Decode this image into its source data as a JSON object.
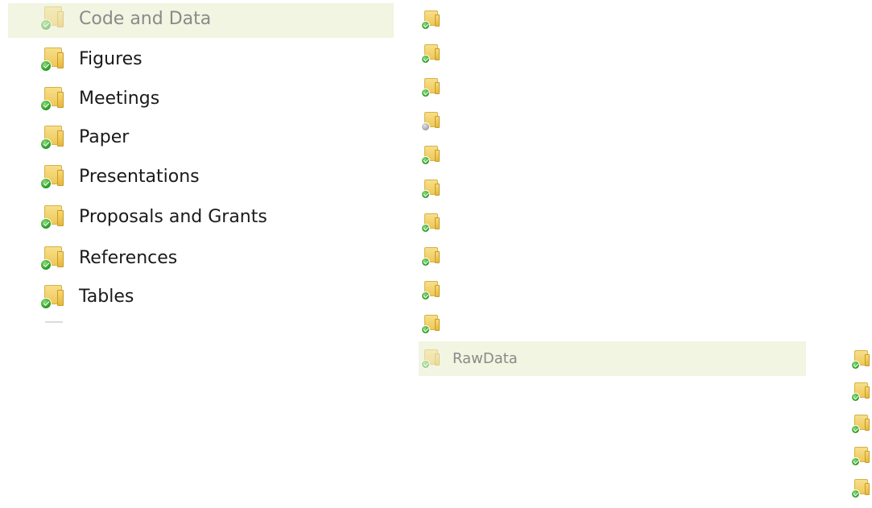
{
  "left_list": {
    "items": [
      {
        "label": "Code and Data",
        "status": "ok",
        "selected": true
      },
      {
        "label": "Figures",
        "status": "ok"
      },
      {
        "label": "Meetings",
        "status": "ok"
      },
      {
        "label": "Paper",
        "status": "ok"
      },
      {
        "label": "Presentations",
        "status": "ok"
      },
      {
        "label": "Proposals and Grants",
        "status": "ok"
      },
      {
        "label": "References",
        "status": "ok"
      },
      {
        "label": "Tables",
        "status": "ok"
      }
    ]
  },
  "middle_column": {
    "icons": [
      "ok",
      "ok",
      "ok",
      "gray",
      "ok",
      "ok",
      "ok",
      "ok",
      "ok",
      "ok"
    ],
    "selected_item": {
      "label": "RawData",
      "status": "ok"
    }
  },
  "right_column": {
    "icons": [
      "ok",
      "ok",
      "ok",
      "ok",
      "ok"
    ]
  },
  "colors": {
    "highlight": "#f1f5e1",
    "sync_ok": "#2ea12a",
    "sync_pending": "#a8a8a8",
    "folder": "#eec95a"
  }
}
